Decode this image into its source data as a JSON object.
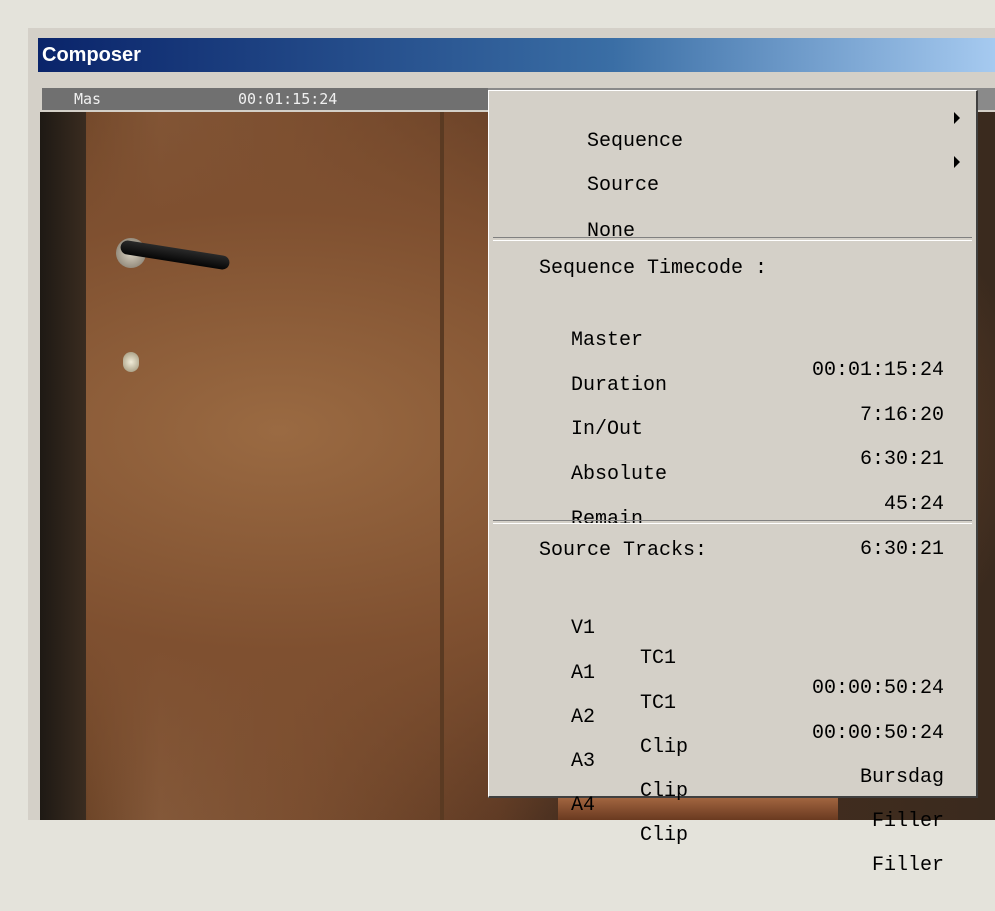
{
  "window": {
    "title": "Composer"
  },
  "timecode_bar": {
    "label": "Mas",
    "value": "00:01:15:24"
  },
  "menu": {
    "items": [
      {
        "label": "Sequence",
        "submenu": true
      },
      {
        "label": "Source",
        "submenu": true
      },
      {
        "label": "None",
        "submenu": false
      }
    ],
    "sequence_header": "Sequence Timecode :",
    "sequence_rows": [
      {
        "label": "Master",
        "value": "00:01:15:24"
      },
      {
        "label": "Duration",
        "value": "7:16:20"
      },
      {
        "label": "In/Out",
        "value": "6:30:21"
      },
      {
        "label": "Absolute",
        "value": "45:24"
      },
      {
        "label": "Remain",
        "value": "6:30:21"
      }
    ],
    "source_header": "Source Tracks:",
    "track_rows": [
      {
        "track": "V1",
        "type": "TC1",
        "value": "00:00:50:24"
      },
      {
        "track": "A1",
        "type": "TC1",
        "value": "00:00:50:24"
      },
      {
        "track": "A2",
        "type": "Clip",
        "value": "Bursdag"
      },
      {
        "track": "A3",
        "type": "Clip",
        "value": "Filler"
      },
      {
        "track": "A4",
        "type": "Clip",
        "value": "Filler"
      }
    ]
  },
  "colors": {
    "titlebar_start": "#0a246a",
    "titlebar_end": "#a6caf0",
    "menu_bg": "#d4d0c8",
    "timecode_bar_bg": "#707070"
  }
}
